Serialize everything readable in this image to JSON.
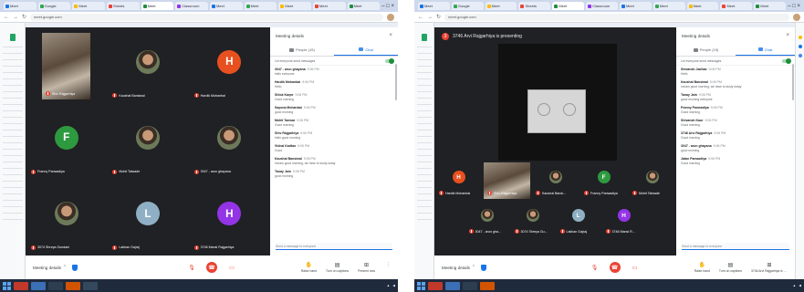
{
  "left": {
    "tabs": [
      "Meet",
      "Google",
      "Meet",
      "Sheets",
      "Meet",
      "Classroom",
      "Meet",
      "Meet",
      "Meet",
      "Meet",
      "Meet"
    ],
    "url": "meet.google.com",
    "panel": {
      "title": "Meeting details",
      "people_tab": "People (15)",
      "chat_tab": "Chat",
      "toggle_label": "Let everyone send messages",
      "messages": [
        {
          "sender": "3047 - arun ghayana",
          "time": "9:06 PM",
          "text": "hello everyone"
        },
        {
          "sender": "Hardik Mohanbai",
          "time": "9:06 PM",
          "text": "Hello"
        },
        {
          "sender": "Shlok Karpe",
          "time": "9:06 PM",
          "text": "Good morning"
        },
        {
          "sender": "Sayona Mohanbai",
          "time": "9:06 PM",
          "text": "good morning"
        },
        {
          "sender": "Mohit Tanwar",
          "time": "9:06 PM",
          "text": "Good morning"
        },
        {
          "sender": "Shiv Rajgarhiya",
          "time": "9:06 PM",
          "text": "hello good morning"
        },
        {
          "sender": "Vishal Kadkar",
          "time": "9:06 PM",
          "text": "Good"
        },
        {
          "sender": "Kaushal Bansiwal",
          "time": "9:06 PM",
          "text": "ma'am good morning, we have to study today"
        },
        {
          "sender": "Tanay Jain",
          "time": "9:06 PM",
          "text": "good morning"
        }
      ],
      "send_placeholder": "Send a message to everyone"
    },
    "tiles": [
      {
        "name": "Shiv Rajgarhiya",
        "kind": "video"
      },
      {
        "name": "Kaushal Bansiwal",
        "kind": "photo"
      },
      {
        "name": "Hardik Mohanbai",
        "kind": "initial",
        "initial": "H",
        "color": "#e8501f"
      },
      {
        "name": "Franny Panwadiya",
        "kind": "initial",
        "initial": "F",
        "color": "#2e9a3f"
      },
      {
        "name": "Mohit Talwade",
        "kind": "photo"
      },
      {
        "name": "3047 - arun ghayana",
        "kind": "photo"
      },
      {
        "name": "3074 Shreya Gundani",
        "kind": "photo"
      },
      {
        "name": "Lakhan Gajraj",
        "kind": "initial",
        "initial": "L",
        "color": "#8fb0c4"
      },
      {
        "name": "3746 Mansi Rajgarhiya",
        "kind": "initial",
        "initial": "H",
        "color": "#9334e6"
      }
    ],
    "controls": {
      "details": "Meeting details",
      "raise": "Raise hand",
      "captions": "Turn on captions",
      "present": "Present now"
    }
  },
  "right": {
    "tabs": [
      "Meet",
      "Google",
      "Meet",
      "Sheets",
      "Meet",
      "Classroom",
      "Meet",
      "Meet",
      "Meet",
      "Meet",
      "Meet"
    ],
    "url": "meet.google.com",
    "banner": "3746 Arvi Rajgarhiya is presenting",
    "panel": {
      "title": "Meeting details",
      "people_tab": "People (15)",
      "chat_tab": "Chat",
      "toggle_label": "Let everyone send messages",
      "messages": [
        {
          "sender": "Shivansh Jadhav",
          "time": "9:06 PM",
          "text": "Hello"
        },
        {
          "sender": "Kaushal Bansiwal",
          "time": "9:06 PM",
          "text": "ma'am good morning, we have to study today"
        },
        {
          "sender": "Tanay Jain",
          "time": "9:06 PM",
          "text": "good morning everyone"
        },
        {
          "sender": "Franny Panwadiya",
          "time": "9:06 PM",
          "text": "Good morning"
        },
        {
          "sender": "Shivansh Kaur",
          "time": "9:06 PM",
          "text": "Good morning"
        },
        {
          "sender": "3746 Arvi Rajgarhiya",
          "time": "9:06 PM",
          "text": "Good morning"
        },
        {
          "sender": "3047 - arun ghayana",
          "time": "9:06 PM",
          "text": "good morning"
        },
        {
          "sender": "Jatan Panwadiya",
          "time": "9:06 PM",
          "text": "Good morning"
        }
      ],
      "send_placeholder": "Send a message to everyone"
    },
    "strip_top": [
      {
        "name": "Hardik Mohanbai",
        "kind": "initial",
        "initial": "H",
        "color": "#e8501f"
      },
      {
        "name": "Shiv Rajgarhiya",
        "kind": "video"
      },
      {
        "name": "Kaushal Bansi...",
        "kind": "photo"
      },
      {
        "name": "Franny Panwadiya",
        "kind": "initial",
        "initial": "F",
        "color": "#2e9a3f"
      },
      {
        "name": "Mohit Talwade",
        "kind": "photo"
      }
    ],
    "strip_bottom": [
      {
        "name": "3047 - arun gha...",
        "kind": "photo"
      },
      {
        "name": "3074 Shreya Gu...",
        "kind": "photo"
      },
      {
        "name": "Lakhan Gajraj",
        "kind": "initial",
        "initial": "L",
        "color": "#8fb0c4"
      },
      {
        "name": "3746 Mansi R...",
        "kind": "initial",
        "initial": "H",
        "color": "#9334e6"
      }
    ],
    "controls": {
      "details": "Meeting details",
      "raise": "Raise hand",
      "captions": "Turn on captions",
      "present": "3746 Arvi Rajgarhiya is presenting"
    }
  },
  "colors": {
    "meet_bg": "#202124",
    "accent": "#1a73e8",
    "danger": "#ea4335"
  }
}
